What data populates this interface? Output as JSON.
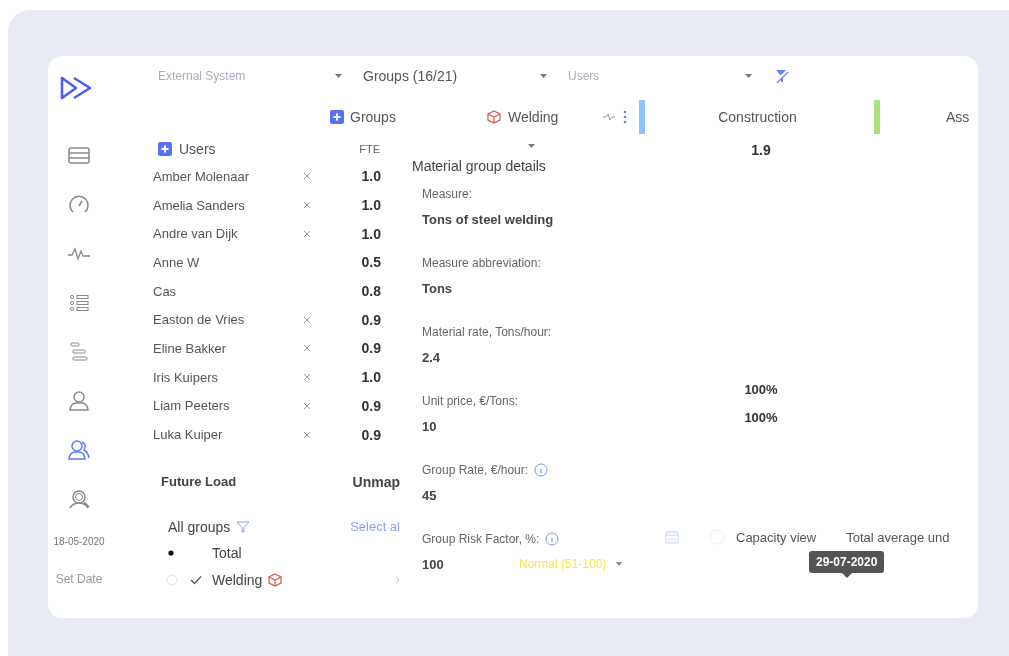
{
  "sidebar": {
    "items": [
      {
        "selected": false
      },
      {
        "selected": false
      },
      {
        "selected": false
      },
      {
        "selected": false
      },
      {
        "selected": false
      },
      {
        "selected": false
      },
      {
        "selected": true
      },
      {
        "selected": false
      }
    ],
    "date": "18-05-2020",
    "set_date": "Set Date"
  },
  "filters": [
    {
      "placeholder": "External System"
    },
    {
      "value": "Groups (16/21)"
    },
    {
      "placeholder": "Users"
    }
  ],
  "group_header": [
    {
      "label": "Groups",
      "kind": "add"
    },
    {
      "label": "Welding",
      "kind": "group",
      "color": "#8ec5fb"
    },
    {
      "label": "Construction",
      "kind": "group",
      "color": "#a8e27c"
    },
    {
      "label": "Ass",
      "kind": "group"
    }
  ],
  "users": {
    "title": "Users",
    "fte_label": "FTE",
    "rows": [
      {
        "name": "Amber Molenaar",
        "removable": true,
        "fte": "1.0"
      },
      {
        "name": "Amelia Sanders",
        "removable": true,
        "fte": "1.0"
      },
      {
        "name": "Andre van Dijk",
        "removable": true,
        "fte": "1.0"
      },
      {
        "name": "Anne W",
        "removable": false,
        "fte": "0.5"
      },
      {
        "name": "Cas",
        "removable": false,
        "fte": "0.8"
      },
      {
        "name": "Easton de Vries",
        "removable": true,
        "fte": "0.9"
      },
      {
        "name": "Eline Bakker",
        "removable": true,
        "fte": "0.9"
      },
      {
        "name": "Iris Kuipers",
        "removable": true,
        "fte": "1.0"
      },
      {
        "name": "Liam Peeters",
        "removable": true,
        "fte": "0.9"
      },
      {
        "name": "Luka Kuiper",
        "removable": true,
        "fte": "0.9"
      }
    ]
  },
  "future_load": {
    "title": "Future Load",
    "unmap": "Unmap",
    "filter_label": "All groups",
    "select_all": "Select al",
    "groups": [
      {
        "label": "Total",
        "kind": "total"
      },
      {
        "label": "Welding",
        "kind": "group",
        "checked": true
      }
    ]
  },
  "details": {
    "title": "Material group details",
    "fields": [
      {
        "label": "Measure:",
        "value": "Tons of steel welding",
        "info": false
      },
      {
        "label": "Measure abbreviation:",
        "value": "Tons",
        "info": false
      },
      {
        "label": "Material rate, Tons/hour:",
        "value": "2.4",
        "info": false
      },
      {
        "label": "Unit price, €/Tons:",
        "value": "10",
        "info": false
      },
      {
        "label": "Group Rate, €/hour:",
        "value": "45",
        "info": true
      },
      {
        "label": "Group Risk Factor, %:",
        "value": "100",
        "info": true,
        "badge": "Normal (51-100)"
      }
    ]
  },
  "summary": {
    "total": "1.9",
    "percentages": [
      "100%",
      "100%"
    ],
    "capacity_view": "Capacity view",
    "average": "Total average und",
    "tooltip": "29-07-2020"
  }
}
